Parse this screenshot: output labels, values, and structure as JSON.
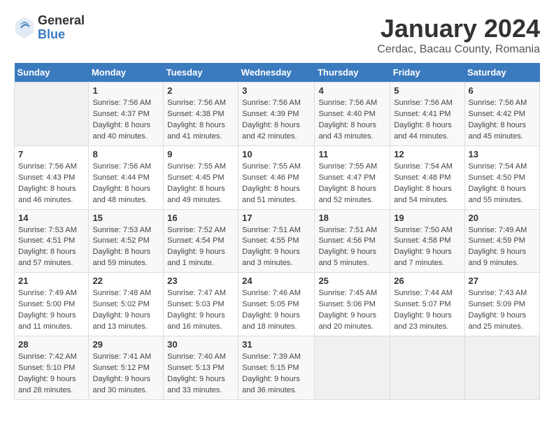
{
  "logo": {
    "general": "General",
    "blue": "Blue"
  },
  "title": "January 2024",
  "subtitle": "Cerdac, Bacau County, Romania",
  "days_header": [
    "Sunday",
    "Monday",
    "Tuesday",
    "Wednesday",
    "Thursday",
    "Friday",
    "Saturday"
  ],
  "weeks": [
    [
      {
        "num": "",
        "info": ""
      },
      {
        "num": "1",
        "info": "Sunrise: 7:56 AM\nSunset: 4:37 PM\nDaylight: 8 hours\nand 40 minutes."
      },
      {
        "num": "2",
        "info": "Sunrise: 7:56 AM\nSunset: 4:38 PM\nDaylight: 8 hours\nand 41 minutes."
      },
      {
        "num": "3",
        "info": "Sunrise: 7:56 AM\nSunset: 4:39 PM\nDaylight: 8 hours\nand 42 minutes."
      },
      {
        "num": "4",
        "info": "Sunrise: 7:56 AM\nSunset: 4:40 PM\nDaylight: 8 hours\nand 43 minutes."
      },
      {
        "num": "5",
        "info": "Sunrise: 7:56 AM\nSunset: 4:41 PM\nDaylight: 8 hours\nand 44 minutes."
      },
      {
        "num": "6",
        "info": "Sunrise: 7:56 AM\nSunset: 4:42 PM\nDaylight: 8 hours\nand 45 minutes."
      }
    ],
    [
      {
        "num": "7",
        "info": "Sunrise: 7:56 AM\nSunset: 4:43 PM\nDaylight: 8 hours\nand 46 minutes."
      },
      {
        "num": "8",
        "info": "Sunrise: 7:56 AM\nSunset: 4:44 PM\nDaylight: 8 hours\nand 48 minutes."
      },
      {
        "num": "9",
        "info": "Sunrise: 7:55 AM\nSunset: 4:45 PM\nDaylight: 8 hours\nand 49 minutes."
      },
      {
        "num": "10",
        "info": "Sunrise: 7:55 AM\nSunset: 4:46 PM\nDaylight: 8 hours\nand 51 minutes."
      },
      {
        "num": "11",
        "info": "Sunrise: 7:55 AM\nSunset: 4:47 PM\nDaylight: 8 hours\nand 52 minutes."
      },
      {
        "num": "12",
        "info": "Sunrise: 7:54 AM\nSunset: 4:48 PM\nDaylight: 8 hours\nand 54 minutes."
      },
      {
        "num": "13",
        "info": "Sunrise: 7:54 AM\nSunset: 4:50 PM\nDaylight: 8 hours\nand 55 minutes."
      }
    ],
    [
      {
        "num": "14",
        "info": "Sunrise: 7:53 AM\nSunset: 4:51 PM\nDaylight: 8 hours\nand 57 minutes."
      },
      {
        "num": "15",
        "info": "Sunrise: 7:53 AM\nSunset: 4:52 PM\nDaylight: 8 hours\nand 59 minutes."
      },
      {
        "num": "16",
        "info": "Sunrise: 7:52 AM\nSunset: 4:54 PM\nDaylight: 9 hours\nand 1 minute."
      },
      {
        "num": "17",
        "info": "Sunrise: 7:51 AM\nSunset: 4:55 PM\nDaylight: 9 hours\nand 3 minutes."
      },
      {
        "num": "18",
        "info": "Sunrise: 7:51 AM\nSunset: 4:56 PM\nDaylight: 9 hours\nand 5 minutes."
      },
      {
        "num": "19",
        "info": "Sunrise: 7:50 AM\nSunset: 4:58 PM\nDaylight: 9 hours\nand 7 minutes."
      },
      {
        "num": "20",
        "info": "Sunrise: 7:49 AM\nSunset: 4:59 PM\nDaylight: 9 hours\nand 9 minutes."
      }
    ],
    [
      {
        "num": "21",
        "info": "Sunrise: 7:49 AM\nSunset: 5:00 PM\nDaylight: 9 hours\nand 11 minutes."
      },
      {
        "num": "22",
        "info": "Sunrise: 7:48 AM\nSunset: 5:02 PM\nDaylight: 9 hours\nand 13 minutes."
      },
      {
        "num": "23",
        "info": "Sunrise: 7:47 AM\nSunset: 5:03 PM\nDaylight: 9 hours\nand 16 minutes."
      },
      {
        "num": "24",
        "info": "Sunrise: 7:46 AM\nSunset: 5:05 PM\nDaylight: 9 hours\nand 18 minutes."
      },
      {
        "num": "25",
        "info": "Sunrise: 7:45 AM\nSunset: 5:06 PM\nDaylight: 9 hours\nand 20 minutes."
      },
      {
        "num": "26",
        "info": "Sunrise: 7:44 AM\nSunset: 5:07 PM\nDaylight: 9 hours\nand 23 minutes."
      },
      {
        "num": "27",
        "info": "Sunrise: 7:43 AM\nSunset: 5:09 PM\nDaylight: 9 hours\nand 25 minutes."
      }
    ],
    [
      {
        "num": "28",
        "info": "Sunrise: 7:42 AM\nSunset: 5:10 PM\nDaylight: 9 hours\nand 28 minutes."
      },
      {
        "num": "29",
        "info": "Sunrise: 7:41 AM\nSunset: 5:12 PM\nDaylight: 9 hours\nand 30 minutes."
      },
      {
        "num": "30",
        "info": "Sunrise: 7:40 AM\nSunset: 5:13 PM\nDaylight: 9 hours\nand 33 minutes."
      },
      {
        "num": "31",
        "info": "Sunrise: 7:39 AM\nSunset: 5:15 PM\nDaylight: 9 hours\nand 36 minutes."
      },
      {
        "num": "",
        "info": ""
      },
      {
        "num": "",
        "info": ""
      },
      {
        "num": "",
        "info": ""
      }
    ]
  ]
}
